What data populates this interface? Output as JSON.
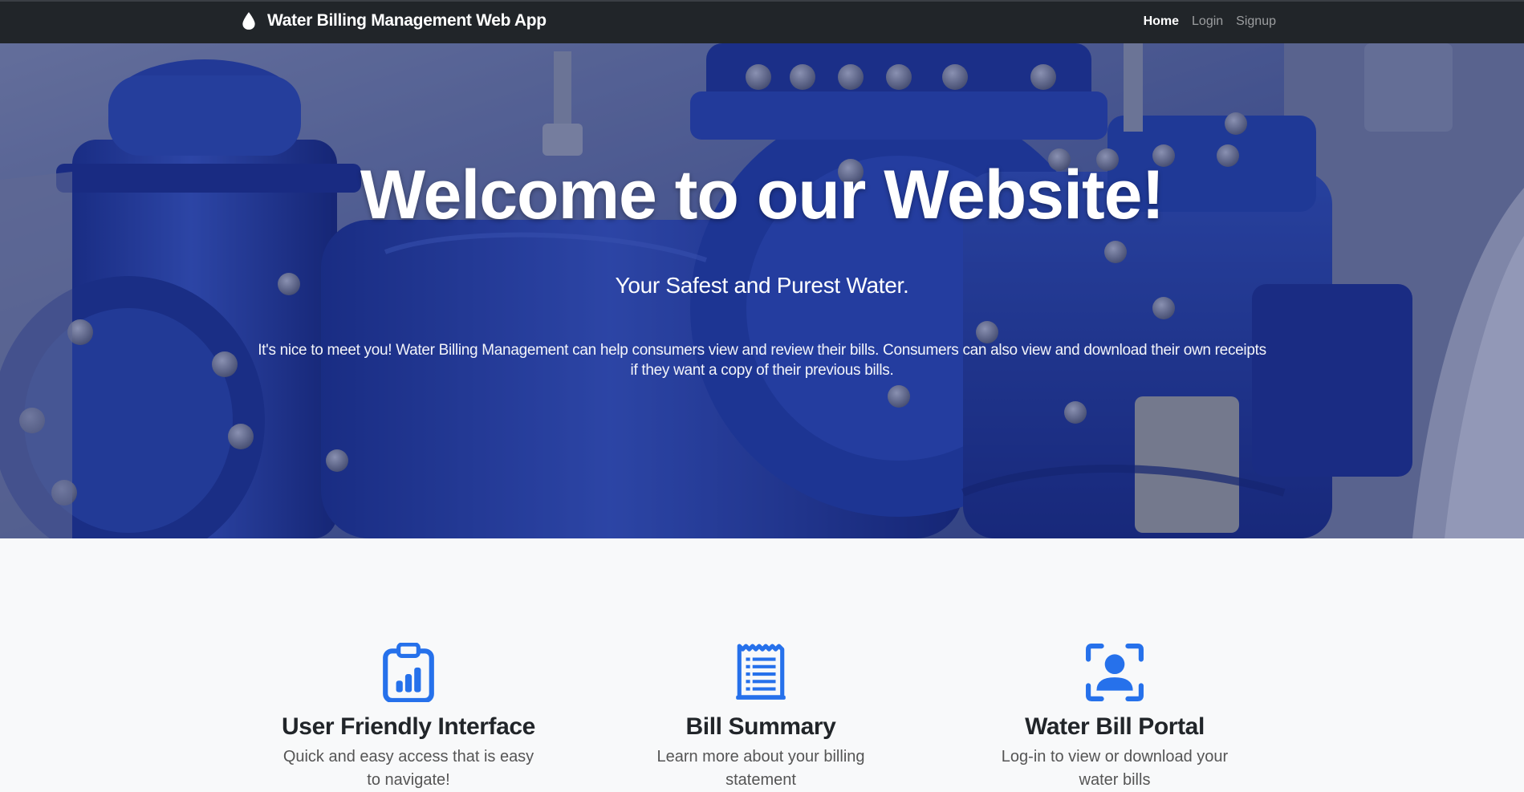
{
  "navbar": {
    "brand": "Water Billing Management Web App",
    "links": [
      {
        "label": "Home",
        "active": true
      },
      {
        "label": "Login",
        "active": false
      },
      {
        "label": "Signup",
        "active": false
      }
    ]
  },
  "hero": {
    "title": "Welcome to our Website!",
    "subtitle": "Your Safest and Purest Water.",
    "text": "It's nice to meet you! Water Billing Management can help consumers view and review their bills. Consumers can also view and download their own receipts if they want a copy of their previous bills."
  },
  "features": [
    {
      "icon": "clipboard-chart-icon",
      "title": "User Friendly Interface",
      "text": "Quick and easy access that is easy to navigate!"
    },
    {
      "icon": "receipt-icon",
      "title": "Bill Summary",
      "text": "Learn more about your billing statement"
    },
    {
      "icon": "person-scan-icon",
      "title": "Water Bill Portal",
      "text": "Log-in to view or download your water bills"
    }
  ],
  "colors": {
    "navbar_bg": "#212529",
    "accent": "#2671eb",
    "hero_tint": "#2a3d82"
  }
}
